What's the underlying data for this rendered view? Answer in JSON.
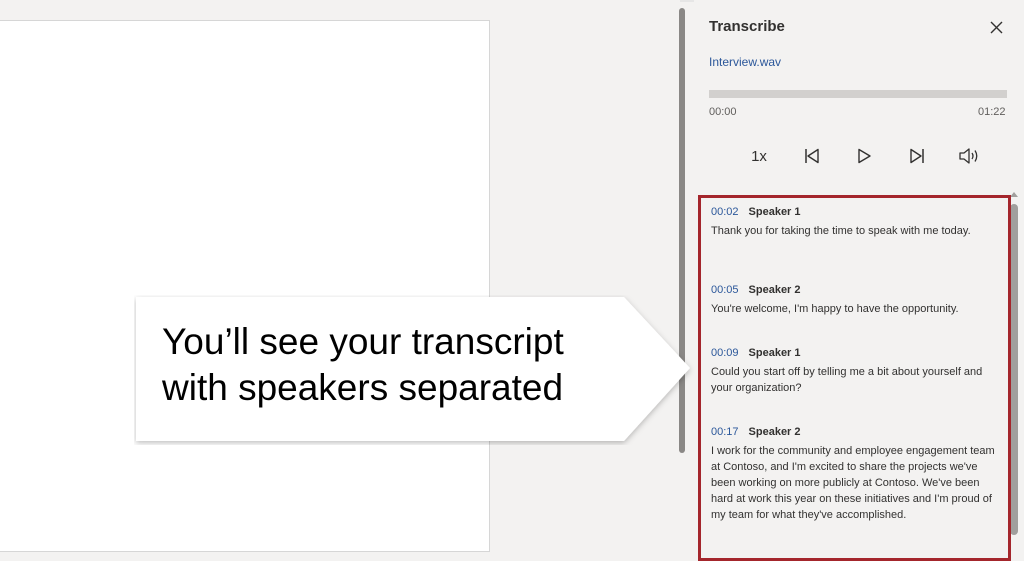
{
  "pane": {
    "title": "Transcribe",
    "file_name": "Interview.wav",
    "progress_fraction": 0.0,
    "time_current": "00:00",
    "time_total": "01:22",
    "speed": "1x"
  },
  "transcript": [
    {
      "time": "00:02",
      "speaker": "Speaker 1",
      "text": "Thank you for taking the time to speak with me today."
    },
    {
      "time": "00:05",
      "speaker": "Speaker 2",
      "text": "You're welcome, I'm happy to have the opportunity."
    },
    {
      "time": "00:09",
      "speaker": "Speaker 1",
      "text": "Could you start off by telling me a bit about yourself and your organization?"
    },
    {
      "time": "00:17",
      "speaker": "Speaker 2",
      "text": "I work for the community and employee engagement team at Contoso, and I'm excited to share the projects we've been working on more publicly at Contoso. We've been hard at work this year on these initiatives and I'm proud of my team for what they've accomplished."
    }
  ],
  "callout": {
    "line1": "You’ll see your transcript",
    "line2": "with speakers separated"
  },
  "colors": {
    "accent_link": "#2b579a",
    "highlight_border": "#a4262c"
  }
}
